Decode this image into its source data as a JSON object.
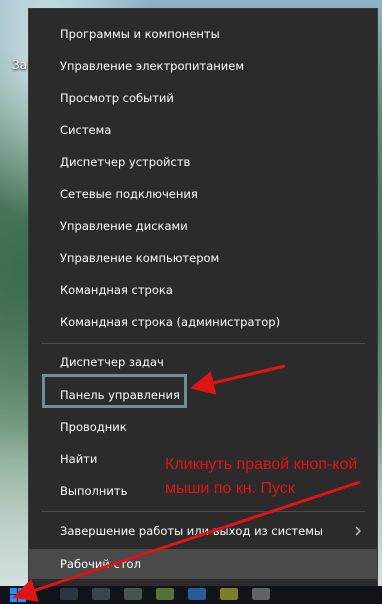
{
  "desktop": {
    "label_fragment": "За"
  },
  "menu": {
    "groups": [
      [
        "Программы и компоненты",
        "Управление электропитанием",
        "Просмотр событий",
        "Система",
        "Диспетчер устройств",
        "Сетевые подключения",
        "Управление дисками",
        "Управление компьютером",
        "Командная строка",
        "Командная строка (администратор)"
      ],
      [
        "Диспетчер задач",
        "Панель управления",
        "Проводник",
        "Найти",
        "Выполнить"
      ],
      [
        "Завершение работы или выход из системы",
        "Рабочий стол"
      ]
    ],
    "flat": {
      "programs": "Программы и компоненты",
      "power": "Управление электропитанием",
      "events": "Просмотр событий",
      "system": "Система",
      "devices": "Диспетчер устройств",
      "network": "Сетевые подключения",
      "disks": "Управление дисками",
      "computer": "Управление компьютером",
      "cmd": "Командная строка",
      "cmd_admin": "Командная строка (администратор)",
      "taskmgr": "Диспетчер задач",
      "control_panel": "Панель управления",
      "explorer": "Проводник",
      "search": "Найти",
      "run": "Выполнить",
      "shutdown": "Завершение работы или выход из системы",
      "desktop": "Рабочий стол"
    },
    "highlighted_item": "Панель управления",
    "active_item": "Рабочий стол",
    "submenu_icon": "chevron-right-icon"
  },
  "annotation": {
    "text": "Кликнуть правой кноп-кой мыши по кн. Пуск",
    "color": "#e01414"
  },
  "colors": {
    "menu_bg": "#2b2b2b",
    "menu_text": "#ffffff",
    "active_bg": "#4a4a4a",
    "highlight_border": "#6c8f90",
    "annotation_red": "#e01414"
  }
}
